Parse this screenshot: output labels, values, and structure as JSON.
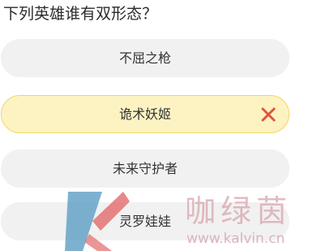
{
  "question": "下列英雄谁有双形态？",
  "options": [
    {
      "label": "不屈之枪"
    },
    {
      "label": "诡术妖姬"
    },
    {
      "label": "未来守护者"
    },
    {
      "label": "灵罗娃娃"
    }
  ],
  "colors": {
    "option_bg": "#f1f1f1",
    "selected_bg": "#fdf3c2",
    "selected_border": "#f1d564",
    "wrong_mark": "#e0553f",
    "watermark": "#d7a8b0",
    "logo_blue": "#5b9fc4",
    "logo_red": "#e36a6a"
  },
  "icons": {
    "wrong": "close-icon"
  },
  "watermark": {
    "brand": "咖绿茵",
    "url": "www.kalvin.cn"
  }
}
